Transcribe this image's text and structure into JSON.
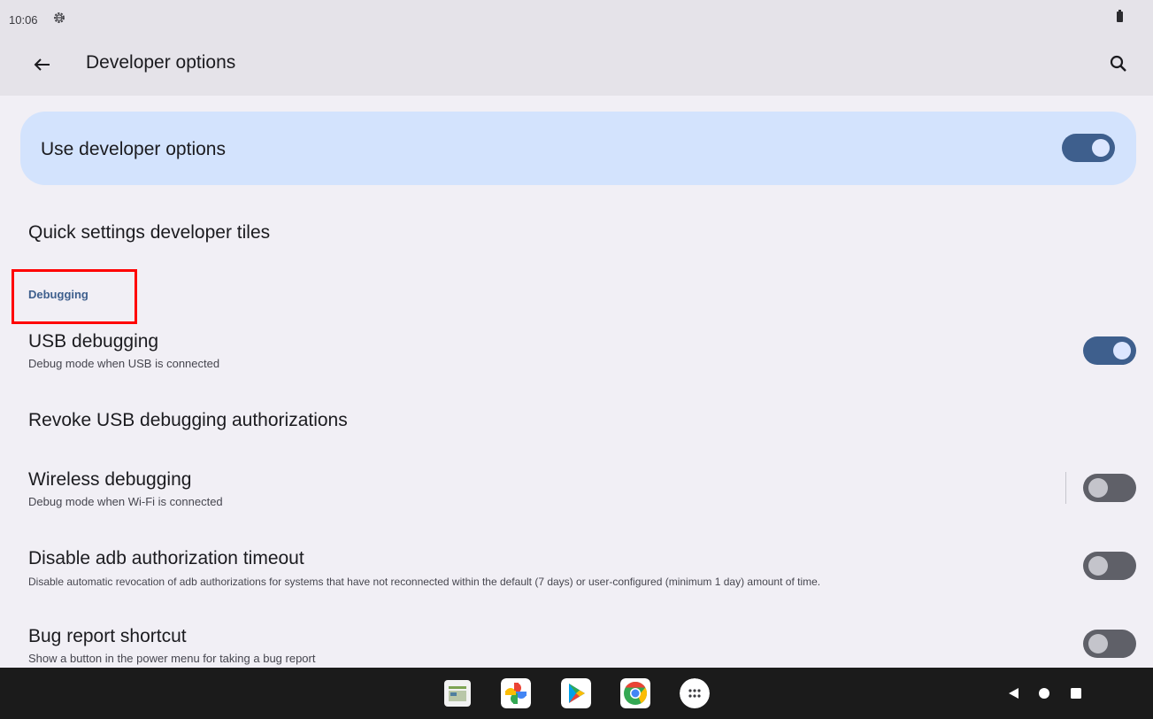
{
  "status_bar": {
    "time": "10:06",
    "icons": [
      "settings-gear-icon",
      "battery-icon"
    ]
  },
  "app_bar": {
    "back_icon": "arrow-back-icon",
    "title": "Developer options",
    "search_icon": "search-icon"
  },
  "master_switch": {
    "label": "Use developer options",
    "checked": true
  },
  "preferences": {
    "quick_tiles": {
      "title": "Quick settings developer tiles"
    },
    "category_debugging": "Debugging",
    "usb_debugging": {
      "title": "USB debugging",
      "summary": "Debug mode when USB is connected",
      "checked": true
    },
    "revoke_usb": {
      "title": "Revoke USB debugging authorizations"
    },
    "wireless_debugging": {
      "title": "Wireless debugging",
      "summary": "Debug mode when Wi-Fi is connected",
      "checked": false
    },
    "disable_adb_timeout": {
      "title": "Disable adb authorization timeout",
      "summary": "Disable automatic revocation of adb authorizations for systems that have not reconnected within the default (7 days) or user-configured (minimum 1 day) amount of time.",
      "checked": false
    },
    "bug_report_shortcut": {
      "title": "Bug report shortcut",
      "summary": "Show a button in the power menu for taking a bug report",
      "checked": false
    }
  },
  "colors": {
    "accent": "#3e5f8d",
    "card_bg": "#d3e3fd",
    "page_bg": "#f1eff5",
    "highlight": "#ff0000"
  },
  "taskbar": {
    "apps": [
      "calendar-app-icon",
      "photos-app-icon",
      "play-store-icon",
      "chrome-icon",
      "app-drawer-icon"
    ],
    "nav": [
      "nav-back-icon",
      "nav-home-icon",
      "nav-recents-icon"
    ]
  }
}
